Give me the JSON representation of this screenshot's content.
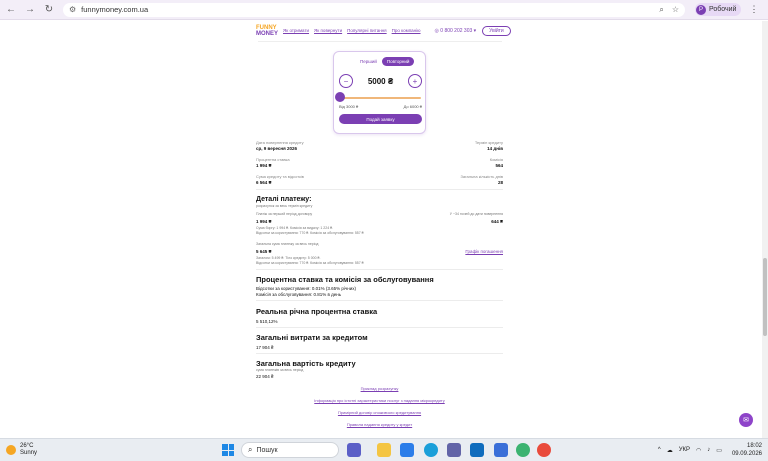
{
  "browser": {
    "url": "funnymoney.com.ua",
    "profile_initial": "Р",
    "profile_name": "Робочий"
  },
  "site": {
    "logo_top": "FUNNY",
    "logo_bottom": "MONEY",
    "nav": [
      "Як отримати",
      "Як повернути",
      "Популярні питання",
      "Про компанію"
    ],
    "phone": "0 800 202 303",
    "login": "Увійти"
  },
  "calculator": {
    "tabs": [
      "Перший",
      "Повторний"
    ],
    "active_tab": 1,
    "amount": "5000 ₴",
    "slider_fraction": 0,
    "min_label": "Від 3000 ₴",
    "max_label": "До 6000 ₴",
    "submit": "Подай заявку",
    "minus": "−",
    "plus": "+"
  },
  "summary": {
    "payment_date_label": "Дата повернення кредиту",
    "payment_date": "ср, 9 вересня 2026",
    "term_label": "Термін кредиту",
    "term": "14 днів",
    "percent_label": "Процентна ставка",
    "percent": "1 994 ₴",
    "commission_label": "Комісія",
    "commission": "564",
    "total_label": "Сума кредиту та відсотків",
    "total": "6 564 ₴",
    "days_label": "Загальна кількість днів",
    "days": "28"
  },
  "details": {
    "title": "Деталі платежу:",
    "subtitle": "розрахунок за весь термін кредиту",
    "first_desc": "Платіж за перший період договору",
    "first_value": "1 994 ₴",
    "first_note1": "Сума боргу: 1 994 ₴. Комісія за видачу: 1 224 ₴.",
    "first_note2": "Відсотки за користування: 770 ₴. Комісія за обслуговування: 557 ₴",
    "right_note": "У ~34 ночей до дати повернення",
    "right_value": "644 ₴",
    "second_desc": "Загальна сума платежу за весь період",
    "second_value": "5 645 ₴",
    "second_note1": "Загалом: 5 499 ₴. Тіло кредиту: 5 000 ₴.",
    "second_note2": "Відсотки за користування: 770 ₴. Комісія за обслуговування: 557 ₴",
    "schedule_link": "Графік погашення"
  },
  "rates": {
    "title": "Процентна ставка та комісія за обслуговування",
    "line1": "Відсотки за користування: 0.01% (3.65% річних)",
    "line2": "Комісія за обслуговування: 0.81% в день"
  },
  "apr": {
    "title": "Реальна річна процентна ставка",
    "value": "5 510,12%"
  },
  "costs": {
    "title": "Загальні витрати за кредитом",
    "value": "17 904 ₴"
  },
  "total_cost": {
    "title": "Загальна вартість кредиту",
    "note": "сума платежів за весь період",
    "value": "22 904 ₴"
  },
  "footer_links": [
    "Приклад розрахунку",
    "Інформація про істотні характеристики послуг з надання мікрокредиту",
    "Примірний договір споживчого кредитування",
    "Правила надання кредиту у кредит"
  ],
  "taskbar": {
    "temp": "26°C",
    "weather": "Sunny",
    "search": "Пошук",
    "lang": "УКР",
    "time": "18:02",
    "date": "09.09.2026"
  },
  "colors": {
    "accent": "#7b3fb3",
    "orange": "#f5a623"
  }
}
